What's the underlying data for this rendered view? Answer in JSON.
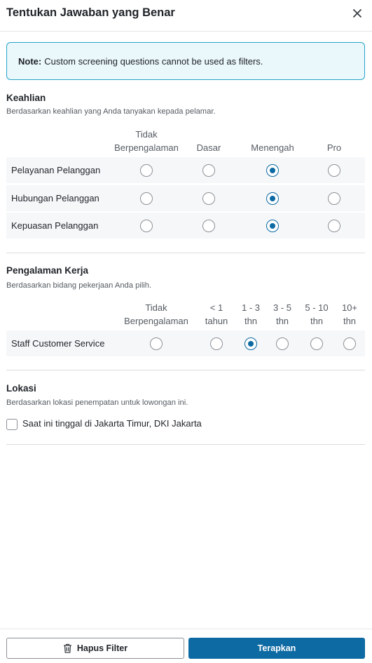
{
  "dialog": {
    "title": "Tentukan Jawaban yang Benar",
    "close_icon": "close-icon"
  },
  "note": {
    "label": "Note:",
    "text": "Custom screening questions cannot be used as filters."
  },
  "skills": {
    "title": "Keahlian",
    "description": "Berdasarkan keahlian yang Anda tanyakan kepada pelamar.",
    "levels": [
      [
        "Tidak",
        "Berpengalaman"
      ],
      [
        "Dasar"
      ],
      [
        "Menengah"
      ],
      [
        "Pro"
      ]
    ],
    "rows": [
      {
        "label": "Pelayanan Pelanggan",
        "selected": 2
      },
      {
        "label": "Hubungan Pelanggan",
        "selected": 2
      },
      {
        "label": "Kepuasan Pelanggan",
        "selected": 2
      }
    ]
  },
  "experience": {
    "title": "Pengalaman Kerja",
    "description": "Berdasarkan bidang pekerjaan Anda pilih.",
    "levels": [
      [
        "Tidak",
        "Berpengalaman"
      ],
      [
        "< 1",
        "tahun"
      ],
      [
        "1 - 3",
        "thn"
      ],
      [
        "3 - 5",
        "thn"
      ],
      [
        "5 - 10",
        "thn"
      ],
      [
        "10+",
        "thn"
      ]
    ],
    "rows": [
      {
        "label": "Staff Customer Service",
        "selected": 2
      }
    ]
  },
  "location": {
    "title": "Lokasi",
    "description": "Berdasarkan lokasi penempatan untuk lowongan ini.",
    "checkbox_label": "Saat ini tinggal di Jakarta Timur, DKI Jakarta",
    "checked": false
  },
  "footer": {
    "clear_label": "Hapus Filter",
    "clear_icon": "trash-icon",
    "apply_label": "Terapkan"
  },
  "colors": {
    "accent": "#0d6aa3",
    "note_border": "#27a4c7",
    "note_bg": "#eaf7fb",
    "row_bg": "#f6f7f9"
  }
}
